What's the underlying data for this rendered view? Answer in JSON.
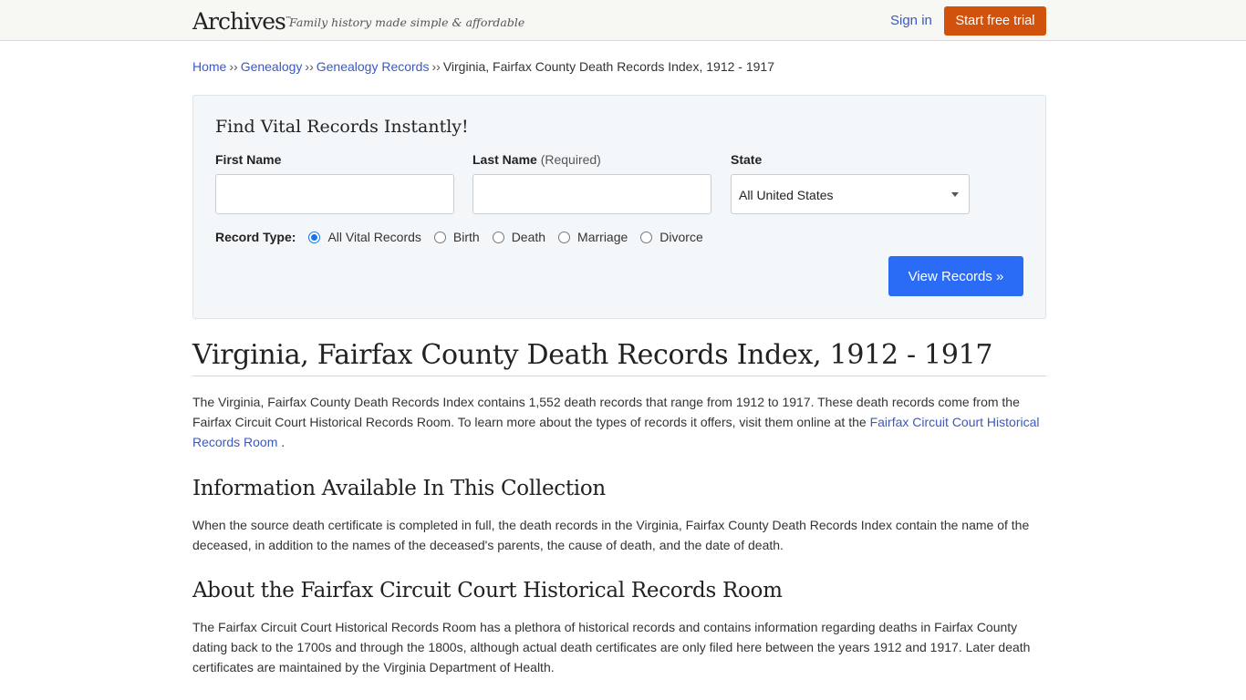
{
  "header": {
    "logo": "Archives",
    "logo_tm": "™",
    "tagline": "Family history made simple & affordable",
    "sign_in": "Sign in",
    "trial_button": "Start free trial"
  },
  "breadcrumb": {
    "items": [
      "Home",
      "Genealogy",
      "Genealogy Records"
    ],
    "separator": "››",
    "current": "Virginia, Fairfax County Death Records Index, 1912 - 1917"
  },
  "search": {
    "title": "Find Vital Records Instantly!",
    "first_name_label": "First Name",
    "first_name_value": "",
    "last_name_label": "Last Name",
    "last_name_required": "(Required)",
    "last_name_value": "",
    "state_label": "State",
    "state_value": "All United States",
    "record_type_label": "Record Type:",
    "record_types": [
      {
        "label": "All Vital Records",
        "selected": true
      },
      {
        "label": "Birth",
        "selected": false
      },
      {
        "label": "Death",
        "selected": false
      },
      {
        "label": "Marriage",
        "selected": false
      },
      {
        "label": "Divorce",
        "selected": false
      }
    ],
    "submit": "View Records »"
  },
  "article": {
    "title": "Virginia, Fairfax County Death Records Index, 1912 - 1917",
    "intro_text": "The Virginia, Fairfax County Death Records Index contains 1,552 death records that range from 1912 to 1917. These death records come from the Fairfax Circuit Court Historical Records Room. To learn more about the types of records it offers, visit them online at the ",
    "intro_link": "Fairfax Circuit Court Historical Records Room",
    "intro_end": " .",
    "section1_title": "Information Available In This Collection",
    "section1_text": "When the source death certificate is completed in full, the death records in the Virginia, Fairfax County Death Records Index contain the name of the deceased, in addition to the names of the deceased's parents, the cause of death, and the date of death.",
    "section2_title": "About the Fairfax Circuit Court Historical Records Room",
    "section2_text": "The Fairfax Circuit Court Historical Records Room has a plethora of historical records and contains information regarding deaths in Fairfax County dating back to the 1700s and through the 1800s, although actual death certificates are only filed here between the years 1912 and 1917. Later death certificates are maintained by the Virginia Department of Health."
  },
  "colors": {
    "link": "#3a58c8",
    "trial_button": "#d0520d",
    "view_button": "#2b6cf6"
  }
}
